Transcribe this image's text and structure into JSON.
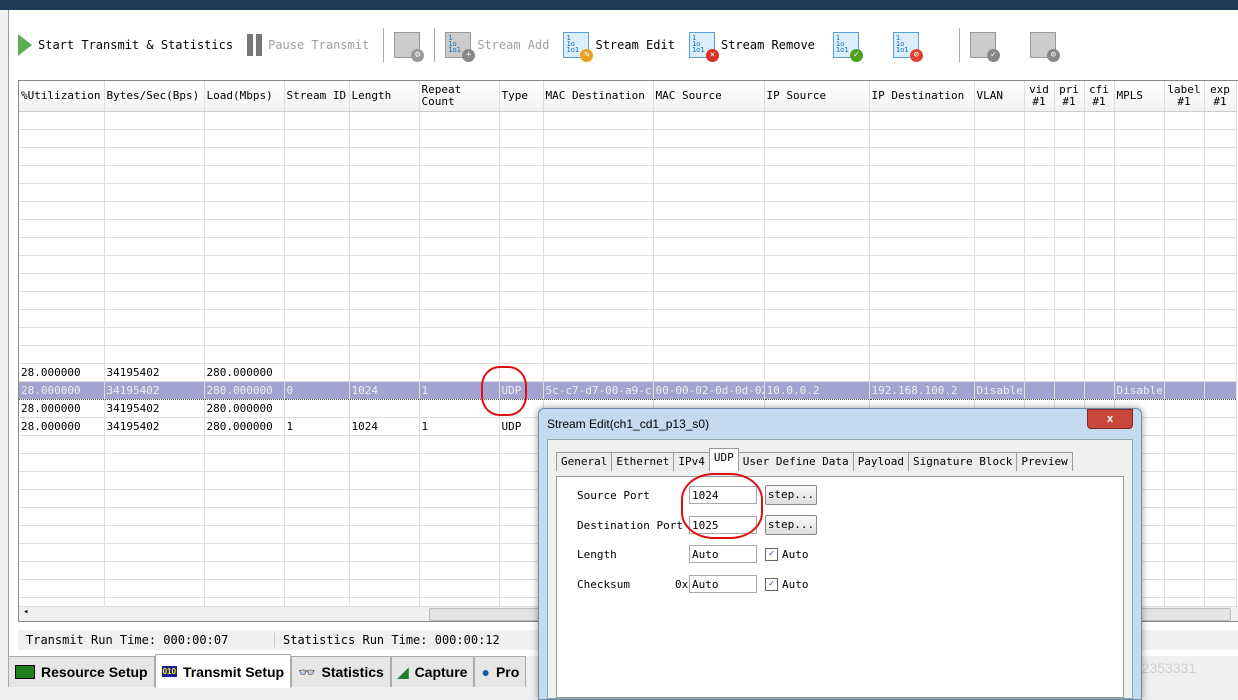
{
  "toolbar": {
    "start": "Start Transmit & Statistics",
    "pause": "Pause Transmit",
    "stream_add": "Stream Add",
    "stream_edit": "Stream Edit",
    "stream_remove": "Stream Remove"
  },
  "table": {
    "headers": [
      "%Utilization",
      "Bytes/Sec(Bps)",
      "Load(Mbps)",
      "Stream ID",
      "Length",
      "Repeat Count",
      "Type",
      "MAC Destination",
      "MAC Source",
      "IP Source",
      "IP Destination",
      "VLAN",
      "vid #1",
      "pri #1",
      "cfi #1",
      "MPLS",
      "label #1",
      "exp #1"
    ],
    "rows": [
      [
        "28.000000",
        "34195402",
        "280.000000",
        "",
        "",
        "",
        "",
        "",
        "",
        "",
        "",
        "",
        "",
        "",
        "",
        "",
        "",
        ""
      ],
      [
        "28.000000",
        "34195402",
        "280.000000",
        "0",
        "1024",
        "1",
        "UDP",
        "5c-c7-d7-00-a9-cf",
        "00-00-02-0d-0d-02",
        "10.0.0.2",
        "192.168.100.2",
        "Disable",
        "",
        "",
        "",
        "Disable",
        "",
        ""
      ],
      [
        "28.000000",
        "34195402",
        "280.000000",
        "",
        "",
        "",
        "",
        "",
        "",
        "",
        "",
        "",
        "",
        "",
        "",
        "",
        "",
        ""
      ],
      [
        "28.000000",
        "34195402",
        "280.000000",
        "1",
        "1024",
        "1",
        "UDP",
        "",
        "",
        "",
        "",
        "",
        "",
        "",
        "",
        "ble",
        "",
        ""
      ]
    ],
    "selected_row": 1
  },
  "status": {
    "transmit": "Transmit Run Time: 000:00:07",
    "statistics": "Statistics Run Time: 000:00:12"
  },
  "bottom_tabs": [
    "Resource Setup",
    "Transmit Setup",
    "Statistics",
    "Capture",
    "Pro"
  ],
  "dialog": {
    "title": "Stream Edit(ch1_cd1_p13_s0)",
    "close": "x",
    "tabs": [
      "General",
      "Ethernet",
      "IPv4",
      "UDP",
      "User Define Data",
      "Payload",
      "Signature Block",
      "Preview"
    ],
    "active_tab": "UDP",
    "source_port_label": "Source Port",
    "source_port": "1024",
    "dest_port_label": "Destination Port",
    "dest_port": "1025",
    "step": "step...",
    "length_label": "Length",
    "length": "Auto",
    "checksum_label": "Checksum",
    "checksum_prefix": "0x",
    "checksum": "Auto",
    "auto": "Auto",
    "check": "✓"
  },
  "watermark": "https://blog.csdn.net/weixin_42353331"
}
